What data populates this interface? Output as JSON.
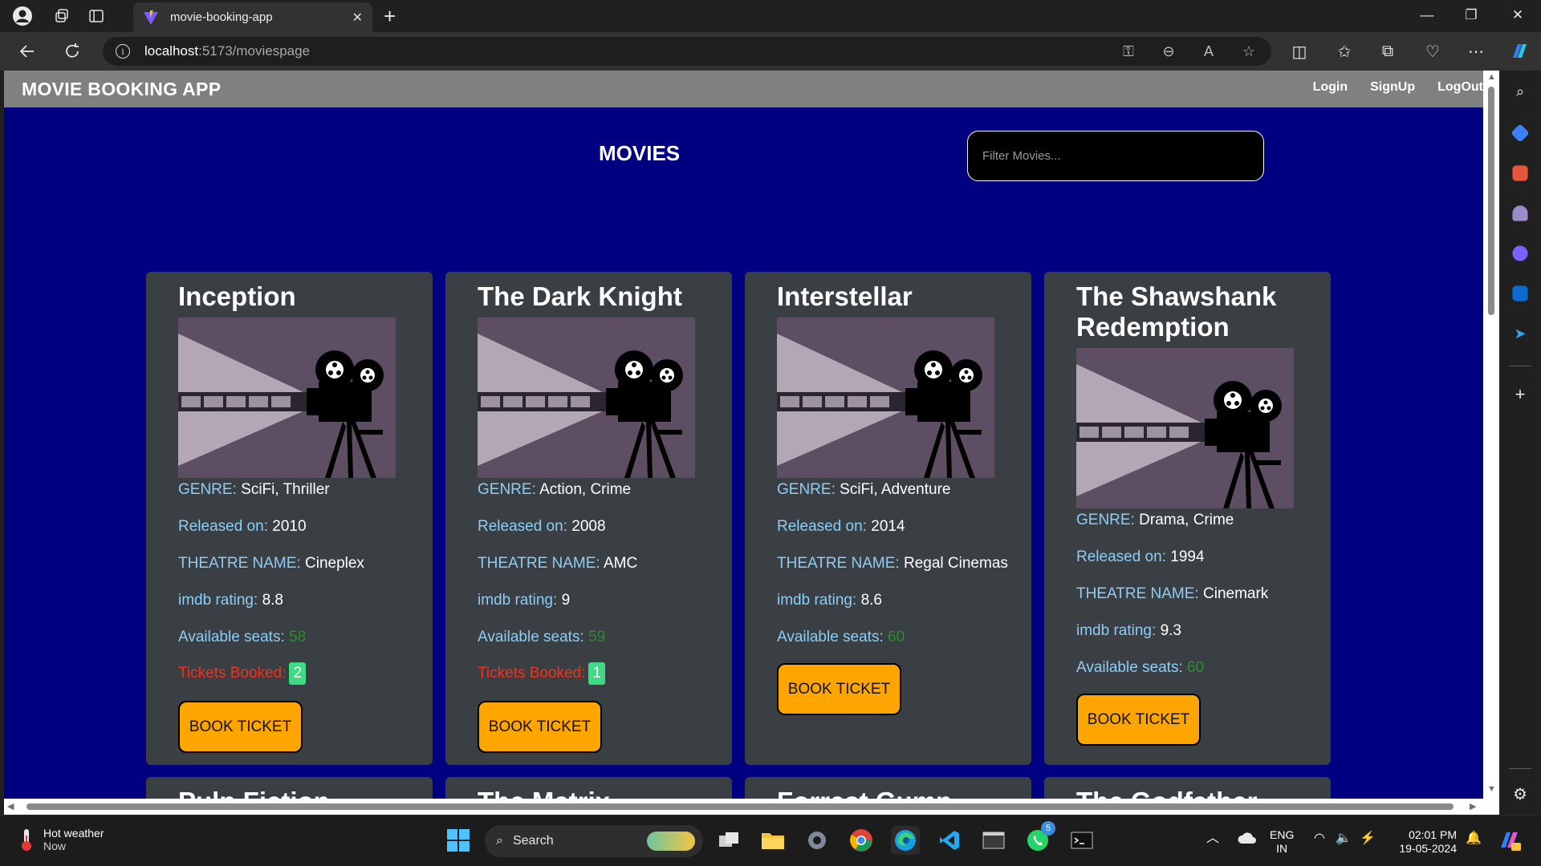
{
  "browser": {
    "tab_title": "movie-booking-app",
    "url_host": "localhost",
    "url_path": ":5173/moviespage"
  },
  "navbar": {
    "brand": "MOVIE BOOKING APP",
    "links": [
      "Login",
      "SignUp",
      "LogOut"
    ]
  },
  "page": {
    "heading": "MOVIES",
    "filter_placeholder": "Filter Movies...",
    "labels": {
      "genre": "GENRE:",
      "released": "Released on:",
      "theatre": "THEATRE NAME:",
      "imdb": "imdb rating:",
      "seats": "Available seats:",
      "tickets": "Tickets Booked:",
      "book": "BOOK TICKET"
    },
    "movies": [
      {
        "title": "Inception",
        "genre": "SciFi, Thriller",
        "released": "2010",
        "theatre": "Cineplex",
        "imdb": "8.8",
        "seats": "58",
        "tickets": "2"
      },
      {
        "title": "The Dark Knight",
        "genre": "Action, Crime",
        "released": "2008",
        "theatre": "AMC",
        "imdb": "9",
        "seats": "59",
        "tickets": "1"
      },
      {
        "title": "Interstellar",
        "genre": "SciFi, Adventure",
        "released": "2014",
        "theatre": "Regal Cinemas",
        "imdb": "8.6",
        "seats": "60"
      },
      {
        "title": "The Shawshank Redemption",
        "genre": "Drama, Crime",
        "released": "1994",
        "theatre": "Cinemark",
        "imdb": "9.3",
        "seats": "60"
      }
    ],
    "next_row_titles": [
      "Pulp Fiction",
      "The Matrix",
      "Forrest Gump",
      "The Godfather"
    ]
  },
  "taskbar": {
    "weather_title": "Hot weather",
    "weather_sub": "Now",
    "search_label": "Search",
    "whatsapp_badge": "5",
    "lang_top": "ENG",
    "lang_bottom": "IN",
    "time": "02:01 PM",
    "date": "19-05-2024"
  },
  "colors": {
    "page_bg": "#000080",
    "navbar_bg": "#808080",
    "card_bg": "#3a3f44",
    "label": "#8ecdf5",
    "button": "#ffa500",
    "tickets_label": "#ff2d16",
    "seats_value": "#2e8b2e"
  }
}
